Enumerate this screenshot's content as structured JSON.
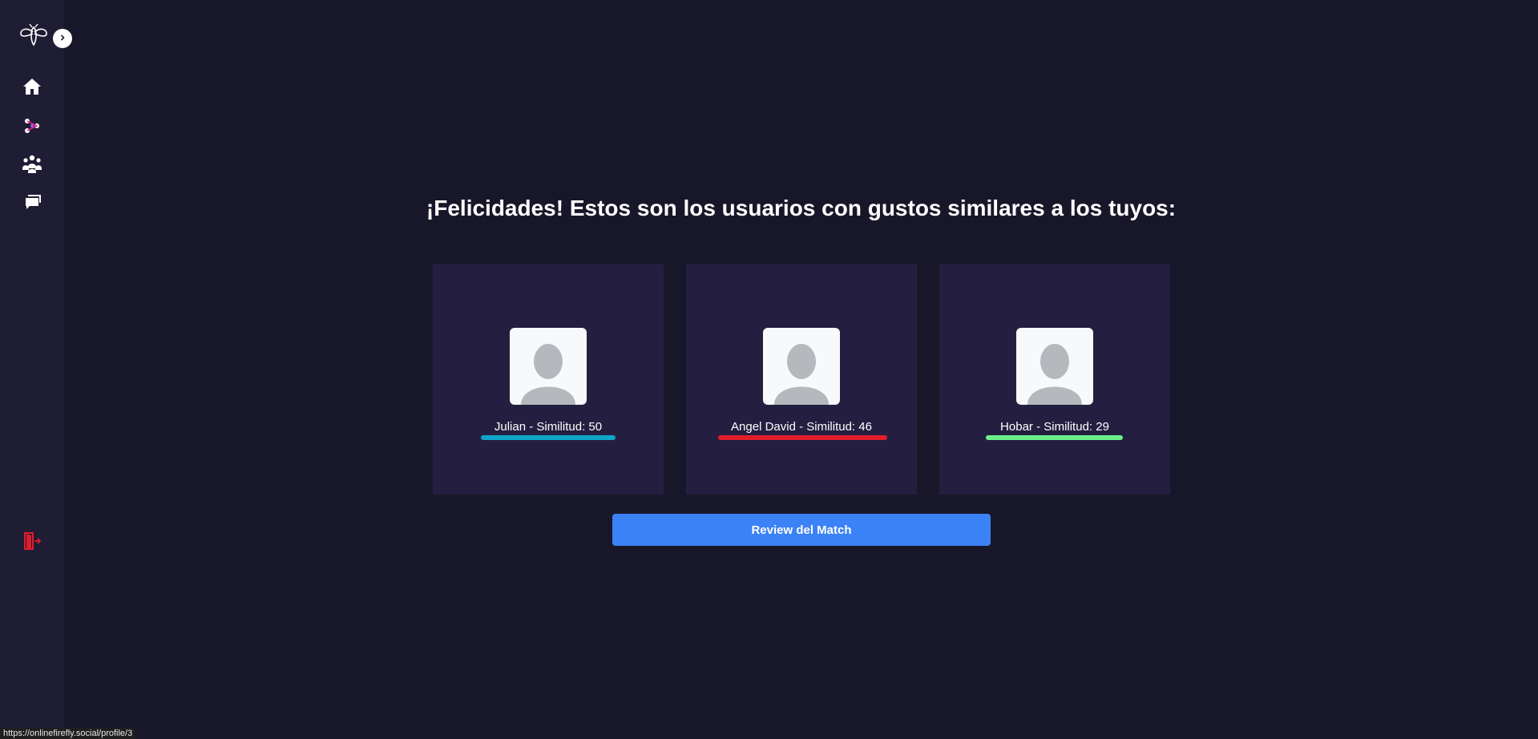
{
  "sidebar": {
    "logo_icon": "firefly-logo-icon",
    "expand_icon": "chevron-right-icon",
    "items": [
      {
        "name": "home",
        "icon": "home-icon"
      },
      {
        "name": "match",
        "icon": "match-icon"
      },
      {
        "name": "community",
        "icon": "users-icon"
      },
      {
        "name": "chat",
        "icon": "chat-icon"
      }
    ],
    "logout_icon": "logout-icon",
    "logout_color": "#e11d2a"
  },
  "main": {
    "headline": "¡Felicidades! Estos son los usuarios con gustos similares a los tuyos:",
    "matches": [
      {
        "label": "Julian - Similitud: 50",
        "name": "Julian",
        "similarity": 50,
        "bar_color": "#0ea5c9"
      },
      {
        "label": "Angel David - Similitud: 46",
        "name": "Angel David",
        "similarity": 46,
        "bar_color": "#e11d2a"
      },
      {
        "label": "Hobar - Similitud: 29",
        "name": "Hobar",
        "similarity": 29,
        "bar_color": "#6cf08a"
      }
    ],
    "review_button": "Review del Match"
  },
  "status_bar": {
    "url": "https://onlinefirefly.social/profile/3"
  }
}
